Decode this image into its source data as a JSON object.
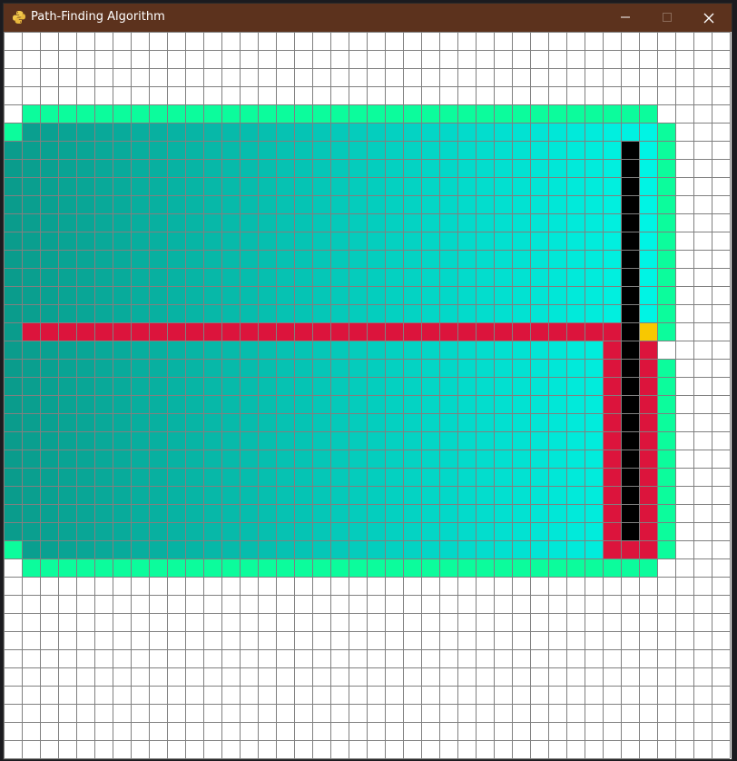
{
  "window": {
    "title": "Path-Finding Algorithm",
    "icon": "python-snake-icon",
    "controls": {
      "minimize": "minimize-icon",
      "maximize": "maximize-icon",
      "close": "close-icon"
    }
  },
  "grid": {
    "rows": 40,
    "cols": 40,
    "line_color": "#808080",
    "colors": {
      "empty": "#ffffff",
      "frontier": "#0cfc9c",
      "visited_dark": "#0a9c8c",
      "visited_light": "#00f4e4",
      "path": "#dc143c",
      "barrier": "#000000",
      "end": "#f8c800"
    },
    "visited_block": {
      "r0": 5,
      "r1": 28,
      "c0": 0,
      "c1": 35
    },
    "frontier_cells": {
      "top_row": {
        "row": 4,
        "c0": 1,
        "c1": 35
      },
      "bottom_row": {
        "row": 29,
        "c0": 1,
        "c1": 35
      },
      "right_col": {
        "col": 36,
        "r0": 5,
        "r1": 28
      },
      "corners": [
        [
          5,
          0
        ],
        [
          28,
          0
        ]
      ],
      "not_frontier": [
        [
          17,
          36
        ]
      ]
    },
    "path_cells": {
      "horizontal": {
        "row": 16,
        "c0": 1,
        "c1": 33
      },
      "left_vertical": {
        "col": 33,
        "r0": 16,
        "r1": 28
      },
      "right_vertical": {
        "col": 35,
        "r0": 17,
        "r1": 28
      },
      "bottom": {
        "row": 28,
        "c0": 33,
        "c1": 35
      }
    },
    "barrier_cells": {
      "col": 34,
      "r0": 6,
      "r1": 27
    },
    "end_cell": {
      "row": 16,
      "col": 35
    }
  }
}
